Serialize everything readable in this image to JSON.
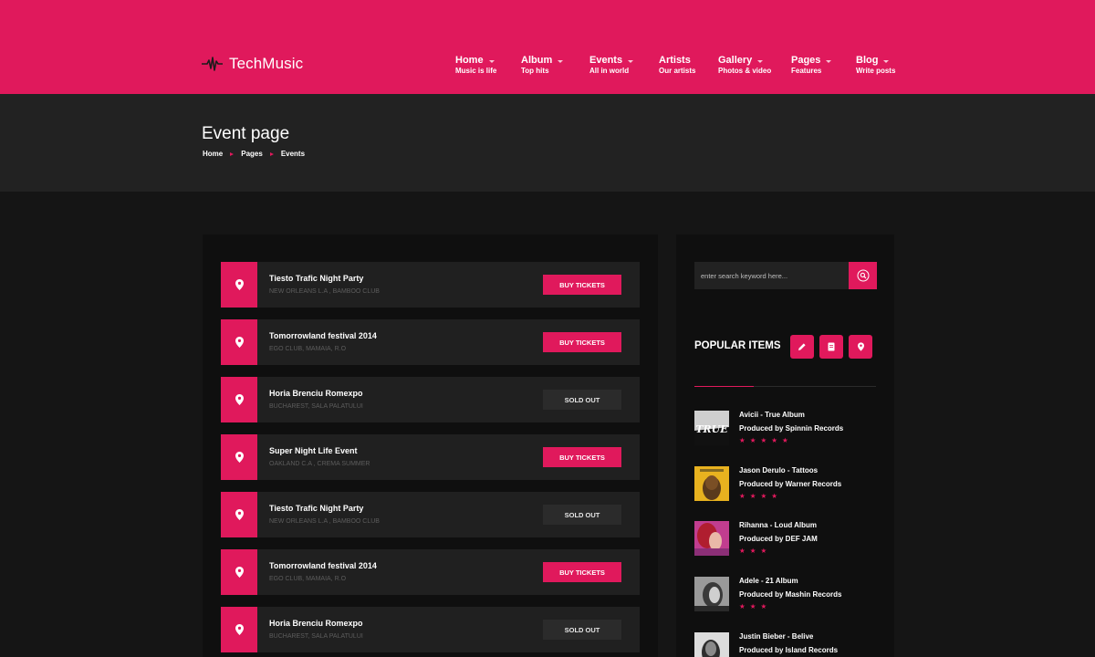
{
  "brand": {
    "name": "TechMusic",
    "accent": "#e0195c",
    "logo_icon": "pulse-wave-icon"
  },
  "nav": [
    {
      "label": "Home",
      "sub": "Music is life",
      "dropdown": true
    },
    {
      "label": "Album",
      "sub": "Top hits",
      "dropdown": true
    },
    {
      "label": "Events",
      "sub": "All in world",
      "dropdown": true
    },
    {
      "label": "Artists",
      "sub": "Our artists",
      "dropdown": false
    },
    {
      "label": "Gallery",
      "sub": "Photos & video",
      "dropdown": true
    },
    {
      "label": "Pages",
      "sub": "Features",
      "dropdown": true
    },
    {
      "label": "Blog",
      "sub": "Write posts",
      "dropdown": true
    }
  ],
  "page": {
    "title": "Event page",
    "breadcrumb": [
      "Home",
      "Pages",
      "Events"
    ]
  },
  "events": [
    {
      "name": "Tiesto Trafic Night Party",
      "venue": "NEW ORLEANS L.A , BAMBOO CLUB",
      "button": "BUY TICKETS",
      "status": "buy",
      "icon": "map-pin-icon"
    },
    {
      "name": "Tomorrowland festival 2014",
      "venue": "EGO CLUB, MAMAIA, R.O",
      "button": "BUY TICKETS",
      "status": "buy",
      "icon": "map-pin-icon"
    },
    {
      "name": "Horia Brenciu Romexpo",
      "venue": "BUCHAREST, SALA PALATULUI",
      "button": "SOLD OUT",
      "status": "sold",
      "icon": "map-pin-icon"
    },
    {
      "name": "Super Night Life Event",
      "venue": "OAKLAND C.A , CREMA SUMMER",
      "button": "BUY TICKETS",
      "status": "buy",
      "icon": "map-pin-icon"
    },
    {
      "name": "Tiesto Trafic Night Party",
      "venue": "NEW ORLEANS L.A , BAMBOO CLUB",
      "button": "SOLD OUT",
      "status": "sold",
      "icon": "map-pin-icon"
    },
    {
      "name": "Tomorrowland festival 2014",
      "venue": "EGO CLUB, MAMAIA, R.O",
      "button": "BUY TICKETS",
      "status": "buy",
      "icon": "map-pin-icon"
    },
    {
      "name": "Horia Brenciu Romexpo",
      "venue": "BUCHAREST, SALA PALATULUI",
      "button": "SOLD OUT",
      "status": "sold",
      "icon": "map-pin-icon"
    }
  ],
  "sidebar": {
    "search": {
      "placeholder": "enter search keyword here...",
      "value": "",
      "icon": "search-icon"
    },
    "popular": {
      "title": "POPULAR ITEMS",
      "tabs": [
        {
          "icon": "pencil-icon"
        },
        {
          "icon": "document-icon"
        },
        {
          "icon": "map-pin-icon"
        }
      ],
      "items": [
        {
          "title": "Avicii - True Album",
          "producer": "Produced by Spinnin Records",
          "rating": 5,
          "rating_max": 5,
          "cover_text": "TRUE"
        },
        {
          "title": "Jason Derulo - Tattoos",
          "producer": "Produced by Warner Records",
          "rating": 4,
          "rating_max": 5,
          "cover_text": ""
        },
        {
          "title": "Rihanna - Loud Album",
          "producer": "Produced by DEF JAM",
          "rating": 3,
          "rating_max": 5,
          "cover_text": ""
        },
        {
          "title": "Adele - 21 Album",
          "producer": "Produced by Mashin Records",
          "rating": 3,
          "rating_max": 5,
          "cover_text": ""
        },
        {
          "title": "Justin Bieber - Belive",
          "producer": "Produced by Island Records",
          "rating": 0,
          "rating_max": 5,
          "cover_text": ""
        }
      ]
    }
  }
}
